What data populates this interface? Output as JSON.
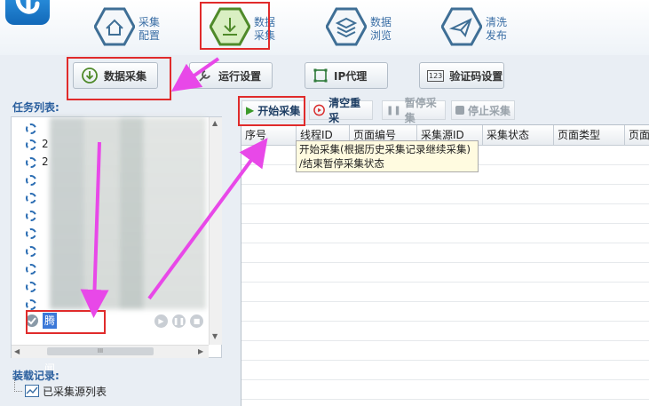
{
  "ribbon": {
    "buttons": [
      {
        "name": "home",
        "line1": "采集",
        "line2": "配置",
        "icon": "home-icon"
      },
      {
        "name": "collect",
        "line1": "数据",
        "line2": "采集",
        "icon": "download-icon"
      },
      {
        "name": "browse",
        "line1": "数据",
        "line2": "浏览",
        "icon": "layers-icon"
      },
      {
        "name": "publish",
        "line1": "清洗",
        "line2": "发布",
        "icon": "paper-plane-icon"
      }
    ]
  },
  "toolbar": {
    "collect_label": "数据采集",
    "run_settings_label": "运行设置",
    "ip_proxy_label": "IP代理",
    "captcha_label": "验证码设置",
    "captcha_icon_text": "123"
  },
  "task_panel": {
    "title": "任务列表:",
    "rows": [
      {
        "text": ""
      },
      {
        "text": "2"
      },
      {
        "text": "2"
      },
      {
        "text": ""
      },
      {
        "text": ""
      },
      {
        "text": ""
      },
      {
        "text": ""
      },
      {
        "text": ""
      },
      {
        "text": ""
      },
      {
        "text": ""
      },
      {
        "text": ""
      }
    ],
    "selected": "腾讯新闻",
    "scroll_thumb": "III"
  },
  "load_panel": {
    "title": "装载记录:",
    "item": "已采集源列表"
  },
  "action_bar": {
    "start": "开始采集",
    "clear": "清空重采",
    "pause": "暂停采集",
    "stop": "停止采集"
  },
  "grid": {
    "columns": [
      "序号",
      "线程ID",
      "页面编号",
      "采集源ID",
      "采集状态",
      "页面类型",
      "页面"
    ]
  },
  "tooltip": {
    "line1": "开始采集(根据历史采集记录继续采集)",
    "line2": "/结束暂停采集状态"
  },
  "colors": {
    "highlight": "#e02b2b",
    "arrow": "#e848e8",
    "accent": "#3b78d8"
  }
}
